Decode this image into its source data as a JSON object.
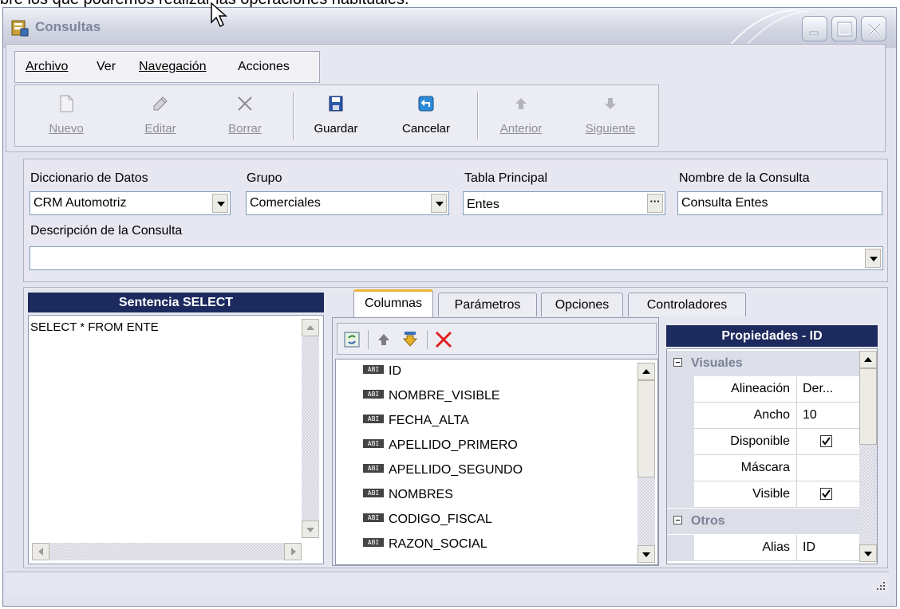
{
  "caption": "bre los que podremos realizar las operaciones habituales.",
  "window": {
    "title": "Consultas"
  },
  "menu": {
    "items": [
      "Archivo",
      "Ver",
      "Navegación",
      "Acciones"
    ]
  },
  "toolbar": {
    "buttons": [
      {
        "label": "Nuevo",
        "enabled": false,
        "icon": "new-document-icon"
      },
      {
        "label": "Editar",
        "enabled": false,
        "icon": "edit-pencil-icon"
      },
      {
        "label": "Borrar",
        "enabled": false,
        "icon": "delete-x-icon"
      },
      {
        "label": "Guardar",
        "enabled": true,
        "icon": "save-disk-icon"
      },
      {
        "label": "Cancelar",
        "enabled": true,
        "icon": "undo-icon"
      },
      {
        "label": "Anterior",
        "enabled": false,
        "icon": "arrow-up-icon"
      },
      {
        "label": "Siguiente",
        "enabled": false,
        "icon": "arrow-down-icon"
      }
    ]
  },
  "form": {
    "diccionario": {
      "label": "Diccionario de Datos",
      "value": "CRM Automotriz"
    },
    "grupo": {
      "label": "Grupo",
      "value": "Comerciales"
    },
    "tabla": {
      "label": "Tabla Principal",
      "value": "Entes"
    },
    "nombre": {
      "label": "Nombre de la Consulta",
      "value": "Consulta Entes"
    },
    "descripcion": {
      "label": "Descripción de la Consulta",
      "value": ""
    }
  },
  "select_panel": {
    "title": "Sentencia SELECT",
    "text": "SELECT * FROM ENTE"
  },
  "tabs": [
    {
      "label": "Columnas",
      "active": true
    },
    {
      "label": "Parámetros",
      "active": false
    },
    {
      "label": "Opciones",
      "active": false
    },
    {
      "label": "Controladores",
      "active": false
    }
  ],
  "columns": [
    "ID",
    "NOMBRE_VISIBLE",
    "FECHA_ALTA",
    "APELLIDO_PRIMERO",
    "APELLIDO_SEGUNDO",
    "NOMBRES",
    "CODIGO_FISCAL",
    "RAZON_SOCIAL"
  ],
  "column_type_badge": "ABI",
  "properties": {
    "title": "Propiedades - ID",
    "categories": [
      {
        "name": "Visuales",
        "rows": [
          {
            "name": "Alineación",
            "value": "Der..."
          },
          {
            "name": "Ancho",
            "value": "10"
          },
          {
            "name": "Disponible",
            "checked": true
          },
          {
            "name": "Máscara",
            "value": ""
          },
          {
            "name": "Visible",
            "checked": true
          }
        ]
      },
      {
        "name": "Otros",
        "rows": [
          {
            "name": "Alias",
            "value": "ID"
          }
        ]
      }
    ]
  },
  "colors": {
    "panel_header": "#1c2a5e",
    "window_bg": "#e3e3ef",
    "delete_red": "#e02020"
  }
}
